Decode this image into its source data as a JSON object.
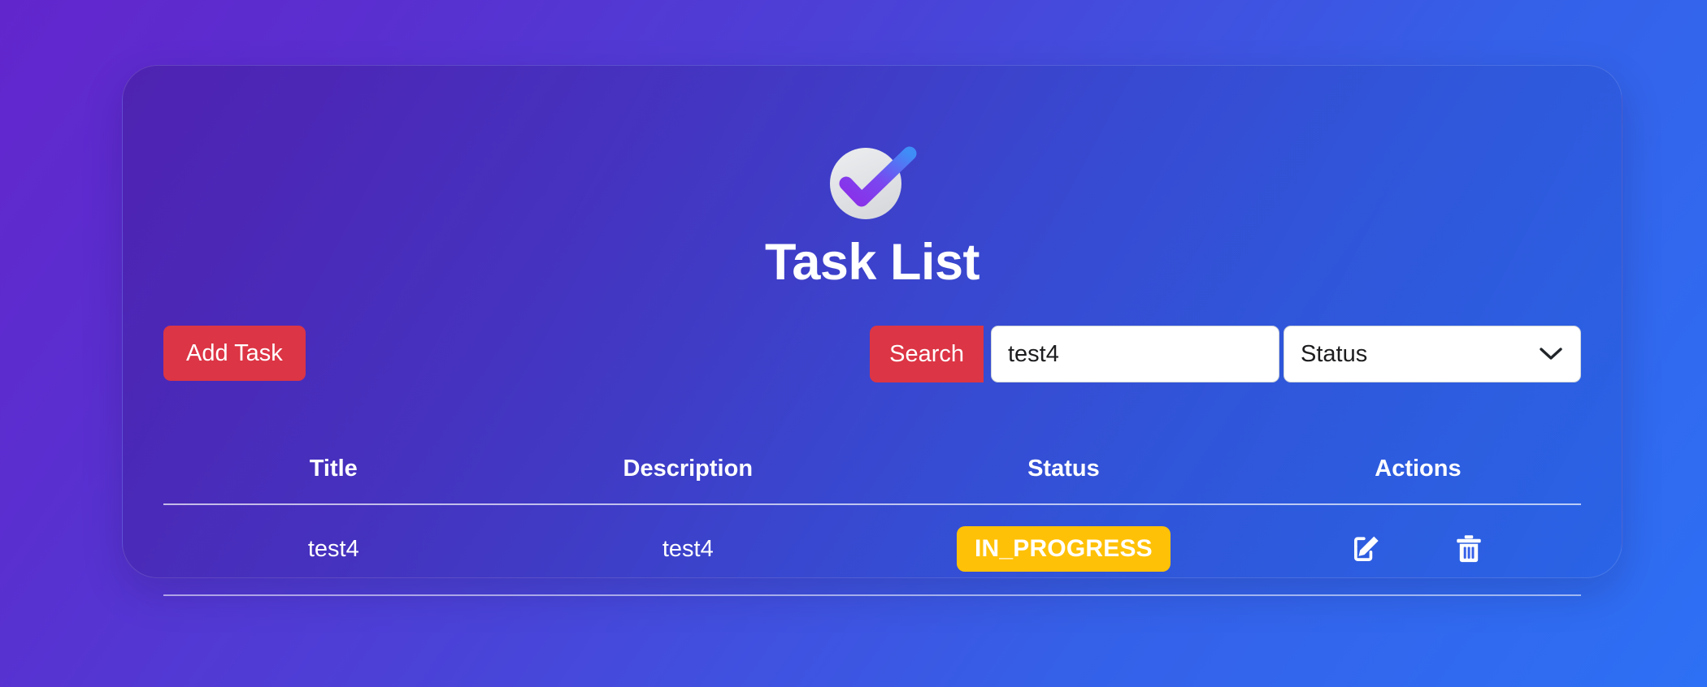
{
  "app": {
    "logo_icon": "check-circle-icon",
    "title": "Task List"
  },
  "toolbar": {
    "add_task_label": "Add Task",
    "search_button_label": "Search",
    "search_input_value": "test4",
    "search_input_placeholder": "Search",
    "status_filter_selected": "Status",
    "status_filter_options": [
      "Status"
    ],
    "chevron_icon": "chevron-down-icon"
  },
  "table": {
    "columns": [
      "Title",
      "Description",
      "Status",
      "Actions"
    ],
    "rows": [
      {
        "title": "test4",
        "description": "test4",
        "status": "IN_PROGRESS",
        "edit_icon": "edit-pencil-icon",
        "delete_icon": "trash-icon"
      }
    ]
  },
  "colors": {
    "background_start": "#6226cd",
    "background_end": "#2d70f5",
    "danger": "#dc3545",
    "warning": "#ffc107",
    "text_on_dark": "#ffffff",
    "input_background": "#ffffff",
    "logo_check_start": "#8b2fe8",
    "logo_check_end": "#3f8ef7"
  }
}
